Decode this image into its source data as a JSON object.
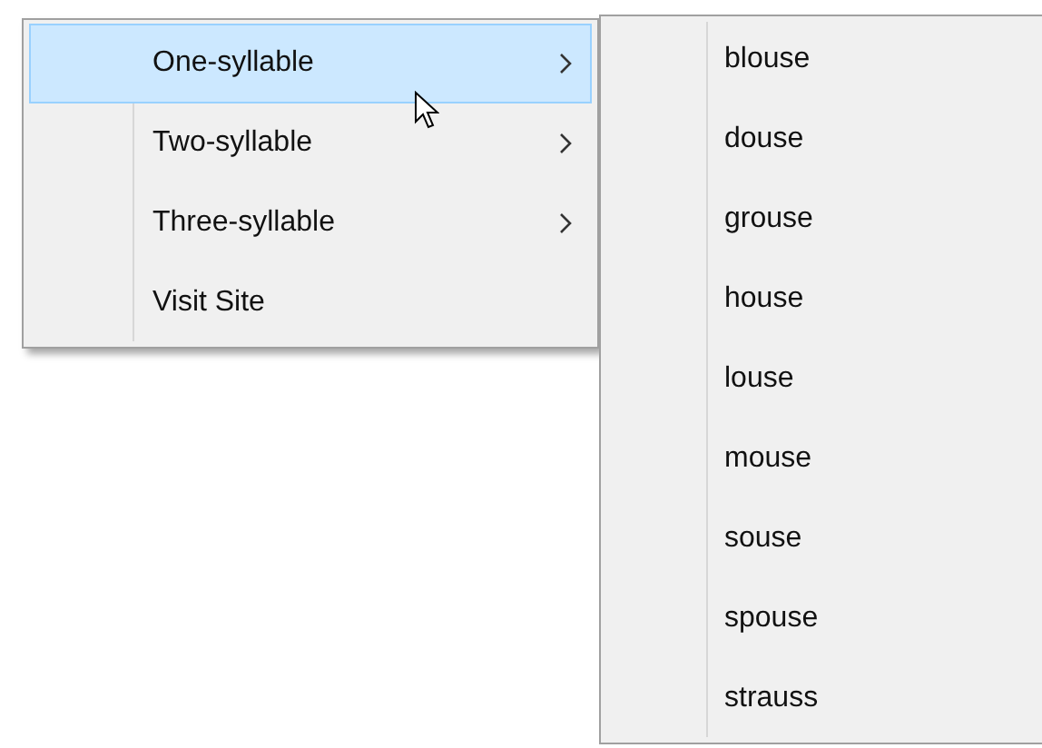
{
  "menu": {
    "items": [
      {
        "label": "One-syllable",
        "selected": true,
        "has_submenu": true
      },
      {
        "label": "Two-syllable",
        "selected": false,
        "has_submenu": true
      },
      {
        "label": "Three-syllable",
        "selected": false,
        "has_submenu": true
      },
      {
        "label": "Visit Site",
        "selected": false,
        "has_submenu": false
      }
    ]
  },
  "submenu": {
    "items": [
      {
        "label": "blouse"
      },
      {
        "label": "douse"
      },
      {
        "label": "grouse"
      },
      {
        "label": "house"
      },
      {
        "label": "louse"
      },
      {
        "label": "mouse"
      },
      {
        "label": "souse"
      },
      {
        "label": "spouse"
      },
      {
        "label": "strauss"
      }
    ]
  }
}
